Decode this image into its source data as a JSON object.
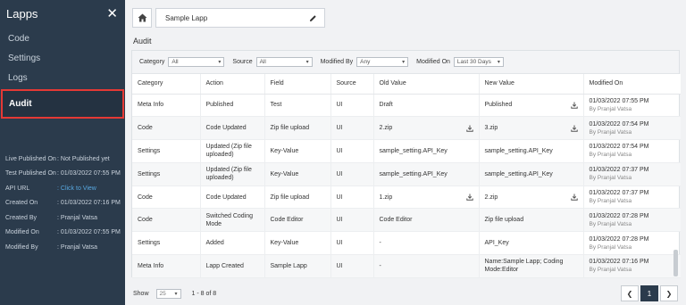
{
  "sidebar": {
    "title": "Lapps",
    "nav": [
      "Code",
      "Settings",
      "Logs",
      "Audit"
    ],
    "active": "Audit",
    "info": [
      {
        "key": "Live Published On",
        "value": ": Not Published yet"
      },
      {
        "key": "Test Published On",
        "value": ": 01/03/2022 07:55 PM"
      },
      {
        "key": "API URL",
        "value": ": Click to View",
        "link": true
      },
      {
        "key": "Created On",
        "value": ": 01/03/2022 07:16 PM"
      },
      {
        "key": "Created By",
        "value": ": Pranjal Vatsa"
      },
      {
        "key": "Modified On",
        "value": ": 01/03/2022 07:55 PM"
      },
      {
        "key": "Modified By",
        "value": ": Pranjal Vatsa"
      }
    ]
  },
  "header": {
    "lapp_name": "Sample Lapp",
    "page_title": "Audit"
  },
  "filters": [
    {
      "label": "Category",
      "value": "All"
    },
    {
      "label": "Source",
      "value": "All"
    },
    {
      "label": "Modified By",
      "value": "Any"
    },
    {
      "label": "Modified On",
      "value": "Last 30 Days"
    }
  ],
  "table": {
    "columns": [
      "Category",
      "Action",
      "Field",
      "Source",
      "Old Value",
      "New Value",
      "Modified On"
    ],
    "rows": [
      {
        "category": "Meta Info",
        "action": "Published",
        "field": "Test",
        "source": "UI",
        "old": "Draft",
        "old_dl": false,
        "new": "Published",
        "new_dl": true,
        "date": "01/03/2022 07:55 PM",
        "by": "By Pranjal Vatsa"
      },
      {
        "category": "Code",
        "action": "Code Updated",
        "field": "Zip file upload",
        "source": "UI",
        "old": "2.zip",
        "old_dl": true,
        "new": "3.zip",
        "new_dl": true,
        "date": "01/03/2022 07:54 PM",
        "by": "By Pranjal Vatsa"
      },
      {
        "category": "Settings",
        "action": "Updated (Zip file uploaded)",
        "field": "Key-Value",
        "source": "UI",
        "old": "sample_setting.API_Key",
        "old_dl": false,
        "new": "sample_setting.API_Key",
        "new_dl": false,
        "date": "01/03/2022 07:54 PM",
        "by": "By Pranjal Vatsa"
      },
      {
        "category": "Settings",
        "action": "Updated (Zip file uploaded)",
        "field": "Key-Value",
        "source": "UI",
        "old": "sample_setting.API_Key",
        "old_dl": false,
        "new": "sample_setting.API_Key",
        "new_dl": false,
        "date": "01/03/2022 07:37 PM",
        "by": "By Pranjal Vatsa"
      },
      {
        "category": "Code",
        "action": "Code Updated",
        "field": "Zip file upload",
        "source": "UI",
        "old": "1.zip",
        "old_dl": true,
        "new": "2.zip",
        "new_dl": true,
        "date": "01/03/2022 07:37 PM",
        "by": "By Pranjal Vatsa"
      },
      {
        "category": "Code",
        "action": "Switched Coding Mode",
        "field": "Code Editor",
        "source": "UI",
        "old": "Code Editor",
        "old_dl": false,
        "new": "Zip file upload",
        "new_dl": false,
        "date": "01/03/2022 07:28 PM",
        "by": "By Pranjal Vatsa"
      },
      {
        "category": "Settings",
        "action": "Added",
        "field": "Key-Value",
        "source": "UI",
        "old": "-",
        "old_dl": false,
        "new": "API_Key",
        "new_dl": false,
        "date": "01/03/2022 07:28 PM",
        "by": "By Pranjal Vatsa"
      },
      {
        "category": "Meta Info",
        "action": "Lapp Created",
        "field": "Sample Lapp",
        "source": "UI",
        "old": "-",
        "old_dl": false,
        "new": "Name:Sample Lapp; Coding Mode:Editor",
        "new_dl": false,
        "date": "01/03/2022 07:16 PM",
        "by": "By Pranjal Vatsa"
      }
    ]
  },
  "footer": {
    "show_label": "Show",
    "page_size": "25",
    "count": "1 - 8 of 8",
    "current_page": "1"
  }
}
